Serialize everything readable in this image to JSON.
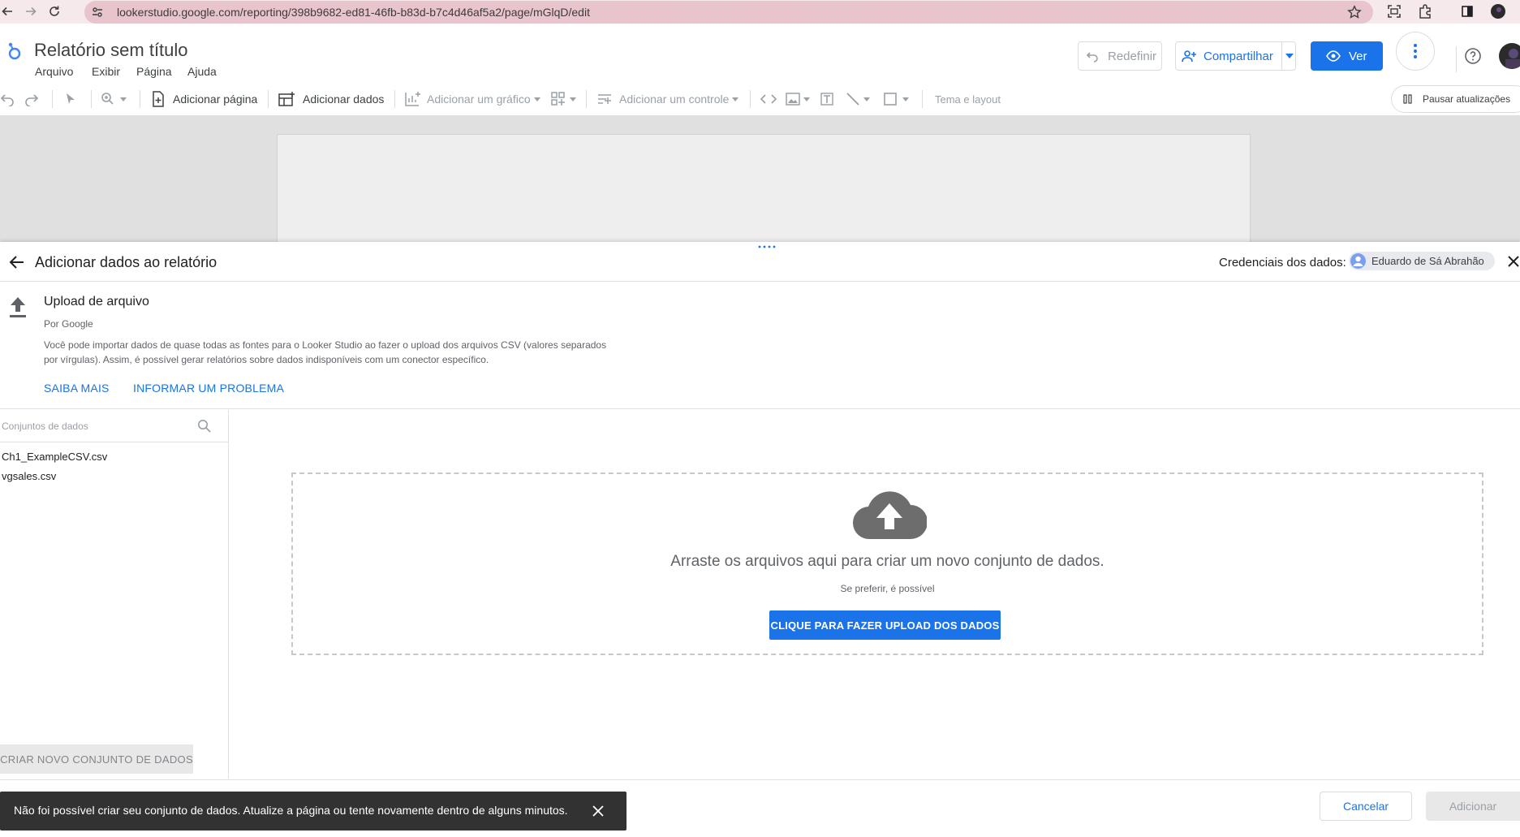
{
  "browser": {
    "url": "lookerstudio.google.com/reporting/398b9682-ed81-46fb-b83d-b7c4d46af5a2/page/mGlqD/edit"
  },
  "header": {
    "title": "Relatório sem título",
    "menu": [
      "Arquivo",
      "Exibir",
      "Página",
      "Ajuda"
    ],
    "reset_label": "Redefinir",
    "share_label": "Compartilhar",
    "view_label": "Ver"
  },
  "toolbar": {
    "add_page": "Adicionar página",
    "add_data": "Adicionar dados",
    "add_chart": "Adicionar um gráfico",
    "add_control": "Adicionar um controle",
    "theme_layout": "Tema e layout",
    "pause_updates": "Pausar atualizações"
  },
  "panel": {
    "title": "Adicionar dados ao relatório",
    "credentials_label": "Credenciais dos dados:",
    "credentials_user": "Eduardo de Sá Abrahão",
    "connector": {
      "name": "Upload de arquivo",
      "by": "Por Google",
      "description_line1": "Você pode importar dados de quase todas as fontes para o Looker Studio ao fazer o upload dos arquivos CSV (valores separados",
      "description_line2": "por vírgulas). Assim, é possível gerar relatórios sobre dados indisponíveis com um conector específico.",
      "learn_more": "SAIBA MAIS",
      "report_problem": "INFORMAR UM PROBLEMA"
    },
    "datasets": {
      "search_placeholder": "Conjuntos de dados",
      "items": [
        "Ch1_ExampleCSV.csv",
        "vgsales.csv"
      ],
      "create_label": "CRIAR NOVO CONJUNTO DE DADOS"
    },
    "dropzone": {
      "title": "Arraste os arquivos aqui para criar um novo conjunto de dados.",
      "subtitle": "Se preferir, é possível",
      "upload_label": "CLIQUE PARA FAZER UPLOAD DOS DADOS"
    },
    "footer": {
      "cancel_label": "Cancelar",
      "add_label": "Adicionar"
    }
  },
  "snackbar": {
    "message": "Não foi possível criar seu conjunto de dados. Atualize a página ou tente novamente dentro de alguns minutos."
  },
  "colors": {
    "accent": "#1a73e8",
    "browser_bar": "#f5e9ec",
    "address_bar": "#e8c4cc",
    "snackbar": "#323232"
  },
  "icons": [
    "back-icon",
    "forward-icon",
    "reload-icon",
    "site-settings-icon",
    "star-icon",
    "screenshot-icon",
    "extensions-icon",
    "sidebar-icon",
    "profile-icon",
    "looker-logo-icon",
    "undo-icon",
    "redo-icon",
    "select-icon",
    "zoom-icon",
    "add-page-icon",
    "add-data-icon",
    "chart-icon",
    "component-icon",
    "control-icon",
    "code-icon",
    "image-icon",
    "text-icon",
    "line-icon",
    "shape-icon",
    "pause-icon",
    "share-person-icon",
    "eye-icon",
    "more-vert-icon",
    "help-icon",
    "arrow-back-icon",
    "avatar-icon",
    "close-icon",
    "upload-icon",
    "search-icon",
    "cloud-upload-icon",
    "drag-handle-icon"
  ]
}
